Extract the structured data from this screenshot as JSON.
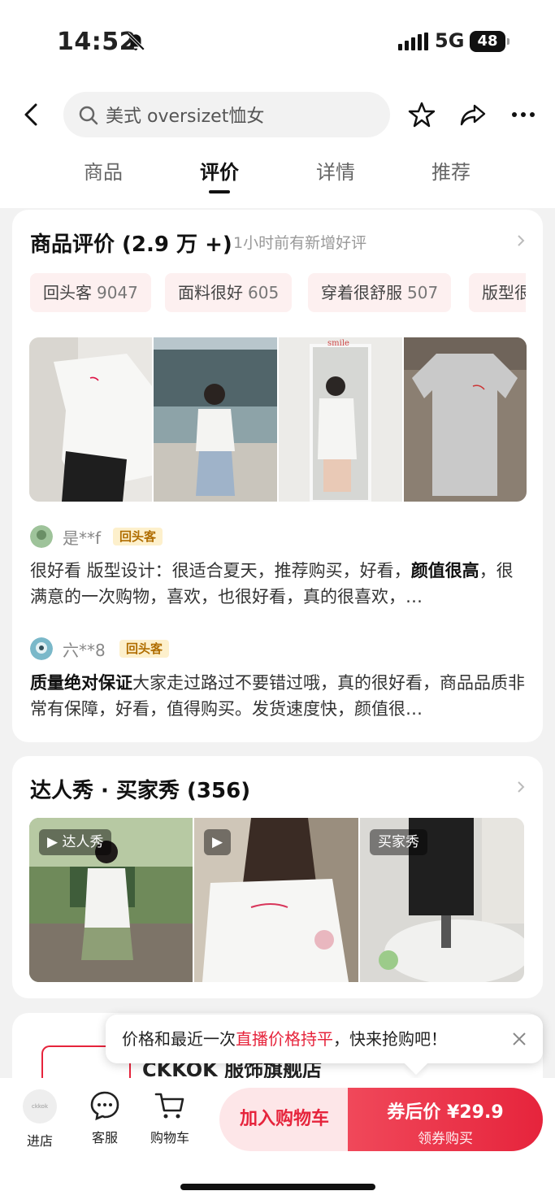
{
  "status_bar": {
    "time": "14:52",
    "network": "5G",
    "battery": "48"
  },
  "search": {
    "query": "美式 oversizet恤女"
  },
  "tabs": [
    {
      "label": "商品",
      "active": false
    },
    {
      "label": "评价",
      "active": true
    },
    {
      "label": "详情",
      "active": false
    },
    {
      "label": "推荐",
      "active": false
    }
  ],
  "reviews": {
    "title": "商品评价 (2.9 万 +)",
    "subtitle": "1小时前有新增好评",
    "tags": [
      {
        "label": "回头客",
        "count": "9047"
      },
      {
        "label": "面料很好",
        "count": "605"
      },
      {
        "label": "穿着很舒服",
        "count": "507"
      },
      {
        "label": "版型很",
        "count": ""
      }
    ],
    "items": [
      {
        "user": "是**f",
        "badge": "回头客",
        "text_before": "很好看 版型设计：很适合夏天，推荐购买，好看，",
        "text_bold": "颜值很高",
        "text_after": "，很满意的一次购物，喜欢，也很好看，真的很喜欢，…"
      },
      {
        "user": "六**8",
        "badge": "回头客",
        "text_before": "",
        "text_bold": "质量绝对保证",
        "text_after": "大家走过路过不要错过哦，真的很好看，商品品质非常有保障，好看，值得购买。发货速度快，颜值很…"
      }
    ]
  },
  "showcase": {
    "title": "达人秀 · 买家秀 (356)",
    "items": [
      {
        "tag": "达人秀",
        "video": true
      },
      {
        "tag": "",
        "video": true
      },
      {
        "tag": "买家秀",
        "video": false
      }
    ]
  },
  "store_card": {
    "name": "CKKOK 服饰旗舰店"
  },
  "tooltip": {
    "text_before": "价格和最近一次",
    "text_highlight": "直播价格持平",
    "text_after": "，快来抢购吧！"
  },
  "bottom_bar": {
    "store_label": "进店",
    "store_logo_text": "ckkok",
    "service_label": "客服",
    "cart_label": "购物车",
    "add_cart_label": "加入购物车",
    "buy_label": "券后价 ¥29.9",
    "buy_sub_label": "领券购买"
  },
  "colors": {
    "accent": "#e6243c",
    "tag_bg": "#fdf0f0",
    "badge_bg": "#fdf0cc"
  }
}
